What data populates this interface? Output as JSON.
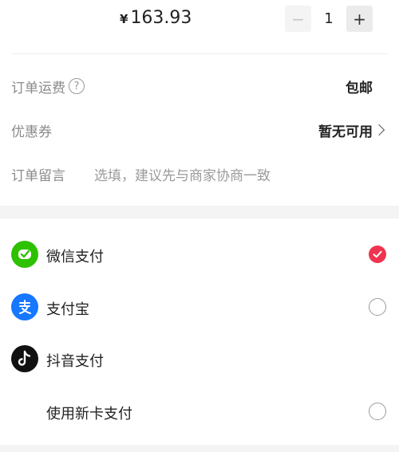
{
  "product": {
    "currency_symbol": "¥",
    "price": "163.93",
    "quantity": "1",
    "minus_label": "−",
    "plus_label": "+"
  },
  "order": {
    "shipping_label": "订单运费",
    "shipping_help": "?",
    "shipping_value": "包邮",
    "coupon_label": "优惠券",
    "coupon_value": "暂无可用",
    "note_label": "订单留言",
    "note_placeholder": "选填，建议先与商家协商一致"
  },
  "payment_methods": [
    {
      "label": "微信支付",
      "icon": "wechat-pay-icon",
      "selected": true
    },
    {
      "label": "支付宝",
      "icon": "alipay-icon",
      "selected": false
    },
    {
      "label": "抖音支付",
      "icon": "douyin-pay-icon",
      "selected": false
    },
    {
      "label": "使用新卡支付",
      "icon": "",
      "selected": false
    }
  ],
  "colors": {
    "accent": "#f0334f",
    "wechat": "#2dc100",
    "alipay": "#1677ff",
    "douyin": "#111111"
  }
}
